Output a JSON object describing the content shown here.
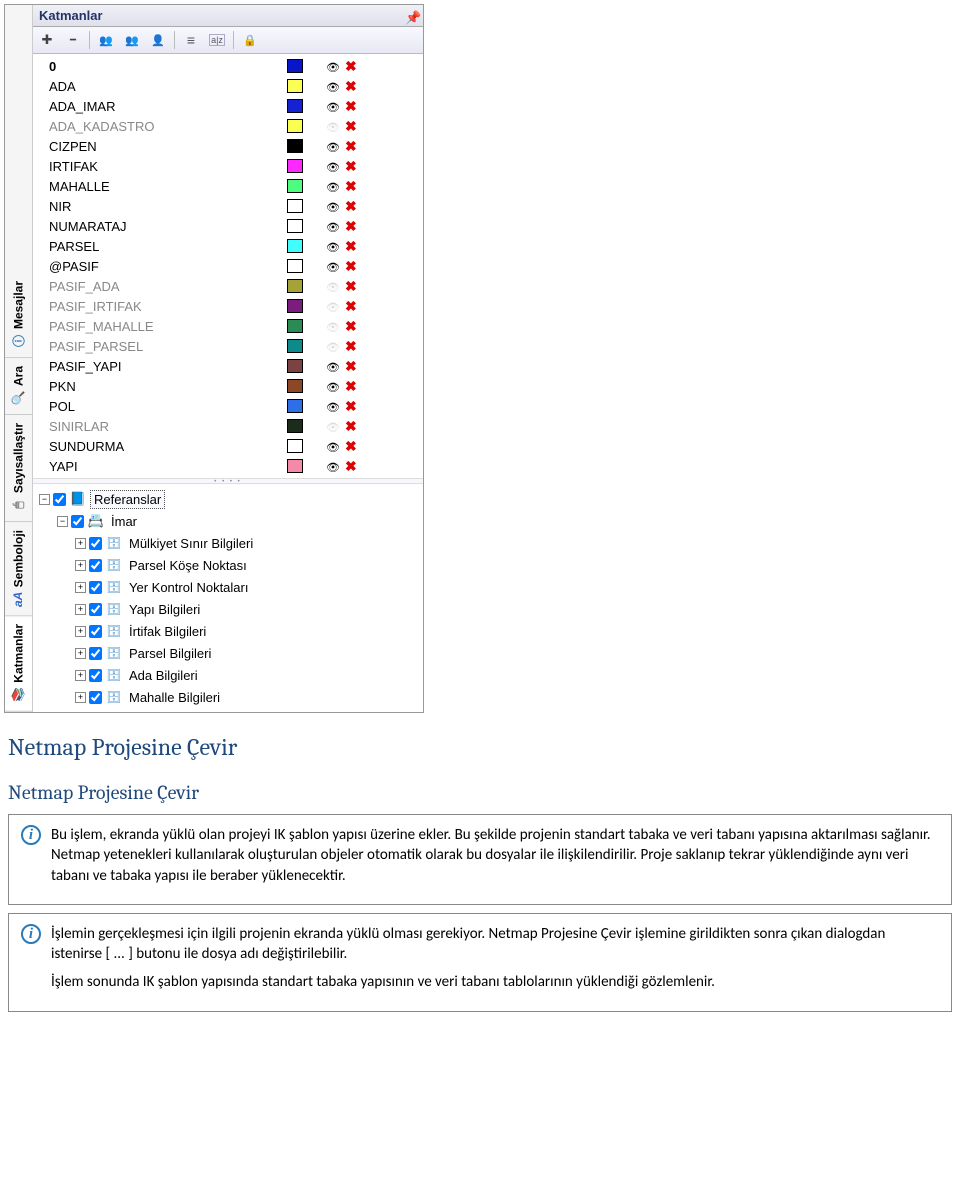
{
  "panel": {
    "title": "Katmanlar",
    "tabs": [
      "Katmanlar",
      "Semboloji",
      "Sayısallaştır",
      "Ara",
      "Mesajlar"
    ],
    "activeTab": "Katmanlar"
  },
  "layers": [
    {
      "name": "0",
      "bold": true,
      "color": "#0915C8",
      "visible": true,
      "gray": false
    },
    {
      "name": "ADA",
      "bold": false,
      "color": "#FBFE54",
      "visible": true,
      "gray": false
    },
    {
      "name": "ADA_IMAR",
      "bold": false,
      "color": "#1522D2",
      "visible": true,
      "gray": false
    },
    {
      "name": "ADA_KADASTRO",
      "bold": false,
      "color": "#F8FE52",
      "visible": false,
      "gray": true
    },
    {
      "name": "CIZPEN",
      "bold": false,
      "color": "#000000",
      "visible": true,
      "gray": false
    },
    {
      "name": "IRTIFAK",
      "bold": false,
      "color": "#FD29FF",
      "visible": true,
      "gray": false
    },
    {
      "name": "MAHALLE",
      "bold": false,
      "color": "#4EFD80",
      "visible": true,
      "gray": false
    },
    {
      "name": "NIR",
      "bold": false,
      "color": "#FFFFFF",
      "visible": true,
      "gray": false
    },
    {
      "name": "NUMARATAJ",
      "bold": false,
      "color": "#FFFFFF",
      "visible": true,
      "gray": false
    },
    {
      "name": "PARSEL",
      "bold": false,
      "color": "#40FEFE",
      "visible": true,
      "gray": false
    },
    {
      "name": "@PASIF",
      "bold": false,
      "color": "#FFFFFF",
      "visible": true,
      "gray": false
    },
    {
      "name": "PASIF_ADA",
      "bold": false,
      "color": "#A3A338",
      "visible": false,
      "gray": true
    },
    {
      "name": "PASIF_IRTIFAK",
      "bold": false,
      "color": "#7A1D7D",
      "visible": false,
      "gray": true
    },
    {
      "name": "PASIF_MAHALLE",
      "bold": false,
      "color": "#2B8B55",
      "visible": false,
      "gray": true
    },
    {
      "name": "PASIF_PARSEL",
      "bold": false,
      "color": "#0F8A8A",
      "visible": false,
      "gray": true
    },
    {
      "name": "PASIF_YAPI",
      "bold": false,
      "color": "#7A4242",
      "visible": true,
      "gray": false
    },
    {
      "name": "PKN",
      "bold": false,
      "color": "#8B4726",
      "visible": true,
      "gray": false
    },
    {
      "name": "POL",
      "bold": false,
      "color": "#2E6FE8",
      "visible": true,
      "gray": false
    },
    {
      "name": "SINIRLAR",
      "bold": false,
      "color": "#1C2B1C",
      "visible": false,
      "gray": true
    },
    {
      "name": "SUNDURMA",
      "bold": false,
      "color": "#FFFFFF",
      "visible": true,
      "gray": false
    },
    {
      "name": "YAPI",
      "bold": false,
      "color": "#F48AA7",
      "visible": true,
      "gray": false
    }
  ],
  "tree": {
    "root": {
      "label": "Referanslar",
      "expanded": true,
      "checked": true,
      "selected": true
    },
    "child": {
      "label": "İmar",
      "expanded": true,
      "checked": true
    },
    "items": [
      "Mülkiyet Sınır Bilgileri",
      "Parsel Köşe Noktası",
      "Yer Kontrol Noktaları",
      "Yapı Bilgileri",
      "İrtifak Bilgileri",
      "Parsel Bilgileri",
      "Ada Bilgileri",
      "Mahalle Bilgileri"
    ]
  },
  "article": {
    "heading1": "Netmap Projesine Çevir",
    "heading2": "Netmap Projesine Çevir",
    "info1": "Bu işlem, ekranda yüklü olan projeyi IK şablon yapısı üzerine ekler. Bu şekilde projenin standart tabaka ve veri tabanı yapısına aktarılması sağlanır. Netmap yetenekleri kullanılarak oluşturulan objeler otomatik olarak bu dosyalar ile ilişkilendirilir. Proje saklanıp tekrar yüklendiğinde aynı veri tabanı ve tabaka yapısı ile beraber yüklenecektir.",
    "info2a": "İşlemin gerçekleşmesi için ilgili projenin ekranda yüklü olması gerekiyor. Netmap Projesine Çevir işlemine girildikten sonra çıkan dialogdan istenirse [ ... ] butonu ile dosya adı değiştirilebilir.",
    "info2b": "İşlem sonunda IK şablon yapısında standart tabaka yapısının ve veri tabanı tablolarının yüklendiği gözlemlenir."
  }
}
